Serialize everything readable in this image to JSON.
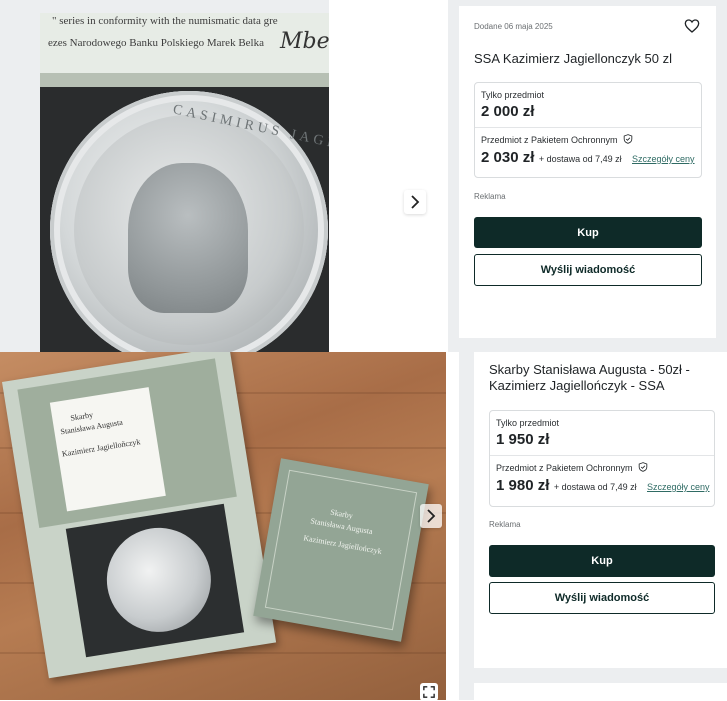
{
  "listing1": {
    "photo": {
      "cert_line1": "\" series in conformity with the numismatic data gre",
      "cert_line2": "ezes Narodowego Banku Polskiego Marek Belka",
      "signature": "Mbel",
      "coin_legend": "CASIMIRUS JAGELLONIDES."
    },
    "date": "Dodane 06 maja 2025",
    "title": "SSA Kazimierz Jagiellonczyk 50 zl",
    "price_only_label": "Tylko przedmiot",
    "price_only": "2 000 zł",
    "price_protected_label": "Przedmiot z Pakietem Ochronnym",
    "price_protected": "2 030 zł",
    "shipping": "+ dostawa od 7,49 zł",
    "price_details_link": "Szczegóły ceny",
    "ad_label": "Reklama",
    "buy_button": "Kup",
    "message_button": "Wyślij wiadomość"
  },
  "listing2": {
    "photo": {
      "box_label1": "Skarby",
      "box_label2": "Stanisława Augusta",
      "box_label3": "Kazimierz Jagielloñczyk",
      "sleeve_label1": "Skarby",
      "sleeve_label2": "Stanisława Augusta",
      "sleeve_label3": "Kazimierz Jagiellończyk"
    },
    "title": "Skarby Stanisława Augusta - 50zł - Kazimierz Jagiellończyk - SSA",
    "price_only_label": "Tylko przedmiot",
    "price_only": "1 950 zł",
    "price_protected_label": "Przedmiot z Pakietem Ochronnym",
    "price_protected": "1 980 zł",
    "shipping": "+ dostawa od 7,49 zł",
    "price_details_link": "Szczegóły ceny",
    "ad_label": "Reklama",
    "buy_button": "Kup",
    "message_button": "Wyślij wiadomość"
  },
  "icons": {
    "next": "chevron-right-icon",
    "favorite": "heart-icon",
    "protection": "shield-check-icon",
    "fullscreen": "expand-icon"
  },
  "colors": {
    "primary_button": "#0e2a28",
    "link": "#2f6b64",
    "page_bg": "#eceef0"
  }
}
